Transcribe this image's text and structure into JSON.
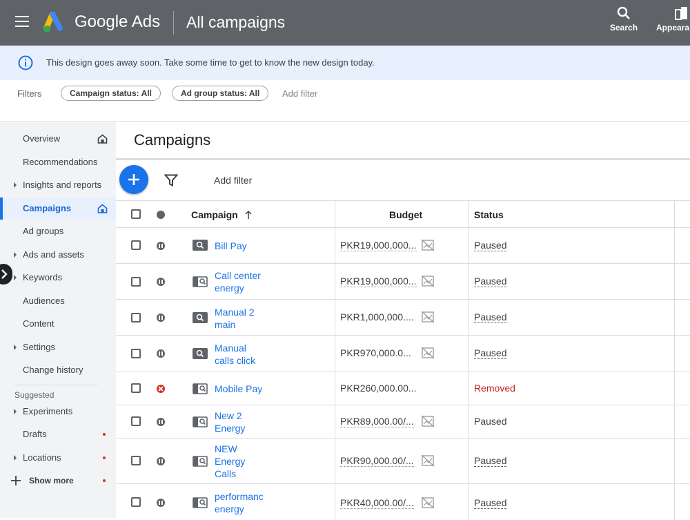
{
  "header": {
    "brand": "Google Ads",
    "page_title": "All campaigns",
    "actions": [
      {
        "label": "Search",
        "icon": "search-icon"
      },
      {
        "label": "Appeara",
        "icon": "appearance-icon"
      }
    ]
  },
  "banner": {
    "message": "This design goes away soon. Take some time to get to know the new design today.",
    "icon": "info-icon"
  },
  "filters": {
    "label": "Filters",
    "chips": [
      "Campaign status: All",
      "Ad group status: All"
    ],
    "add_filter": "Add filter"
  },
  "sidebar": {
    "items": [
      {
        "label": "Overview",
        "home": true
      },
      {
        "label": "Recommendations"
      },
      {
        "label": "Insights and reports",
        "expandable": true
      },
      {
        "label": "Campaigns",
        "active": true,
        "home": true
      },
      {
        "label": "Ad groups"
      },
      {
        "label": "Ads and assets",
        "expandable": true
      },
      {
        "label": "Keywords",
        "expandable": true
      },
      {
        "label": "Audiences"
      },
      {
        "label": "Content"
      },
      {
        "label": "Settings",
        "expandable": true
      },
      {
        "label": "Change history"
      }
    ],
    "suggested_label": "Suggested",
    "suggested_items": [
      {
        "label": "Experiments",
        "expandable": true
      },
      {
        "label": "Drafts",
        "dot": true
      },
      {
        "label": "Locations",
        "expandable": true,
        "dot": true
      },
      {
        "label": "Show more",
        "dot": true
      }
    ]
  },
  "main": {
    "title": "Campaigns",
    "add_filter": "Add filter",
    "columns": {
      "campaign": "Campaign",
      "budget": "Budget",
      "status": "Status"
    },
    "rows": [
      {
        "name": "Bill Pay",
        "budget": "PKR19,000,000...",
        "status": "Paused",
        "type": "search"
      },
      {
        "name": "Call center energy",
        "budget": "PKR19,000,000...",
        "status": "Paused",
        "type": "call"
      },
      {
        "name": "Manual 2 main",
        "budget": "PKR1,000,000....",
        "status": "Paused",
        "type": "search"
      },
      {
        "name": "Manual calls click",
        "budget": "PKR970,000.0...",
        "status": "Paused",
        "type": "search"
      },
      {
        "name": "Mobile Pay",
        "budget": "PKR260,000.00...",
        "status": "Removed",
        "type": "call"
      },
      {
        "name": "New 2 Energy",
        "budget": "PKR89,000.00/...",
        "status": "Paused",
        "type": "call"
      },
      {
        "name": "NEW Energy Calls",
        "budget": "PKR90,000.00/...",
        "status": "Paused",
        "type": "call"
      },
      {
        "name": "performanc energy",
        "budget": "PKR40,000.00/...",
        "status": "Paused",
        "type": "call"
      }
    ]
  },
  "colors": {
    "topbar": "#5f6368",
    "banner": "#e8f0fe",
    "accent": "#1a73e8",
    "removed": "#c5221f"
  }
}
